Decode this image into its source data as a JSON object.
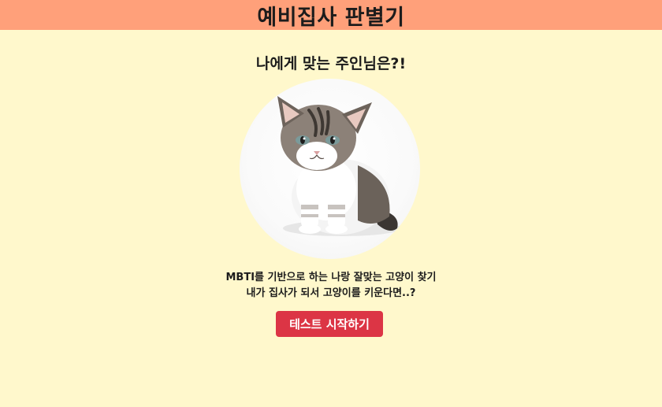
{
  "header": {
    "title": "예비집사 판별기"
  },
  "main": {
    "subtitle": "나에게 맞는 주인님은?!",
    "image_subject": "kitten-photo",
    "description_lines": [
      "MBTI를 기반으로 하는 나랑 잘맞는 고양이 찾기",
      "내가 집사가 되서 고양이를 키운다면..?"
    ],
    "start_button_label": "테스트 시작하기"
  },
  "colors": {
    "header_bg": "#FFA07A",
    "page_bg": "#FFF8CC",
    "button_bg": "#DC3545",
    "button_text": "#FFFFFF"
  }
}
